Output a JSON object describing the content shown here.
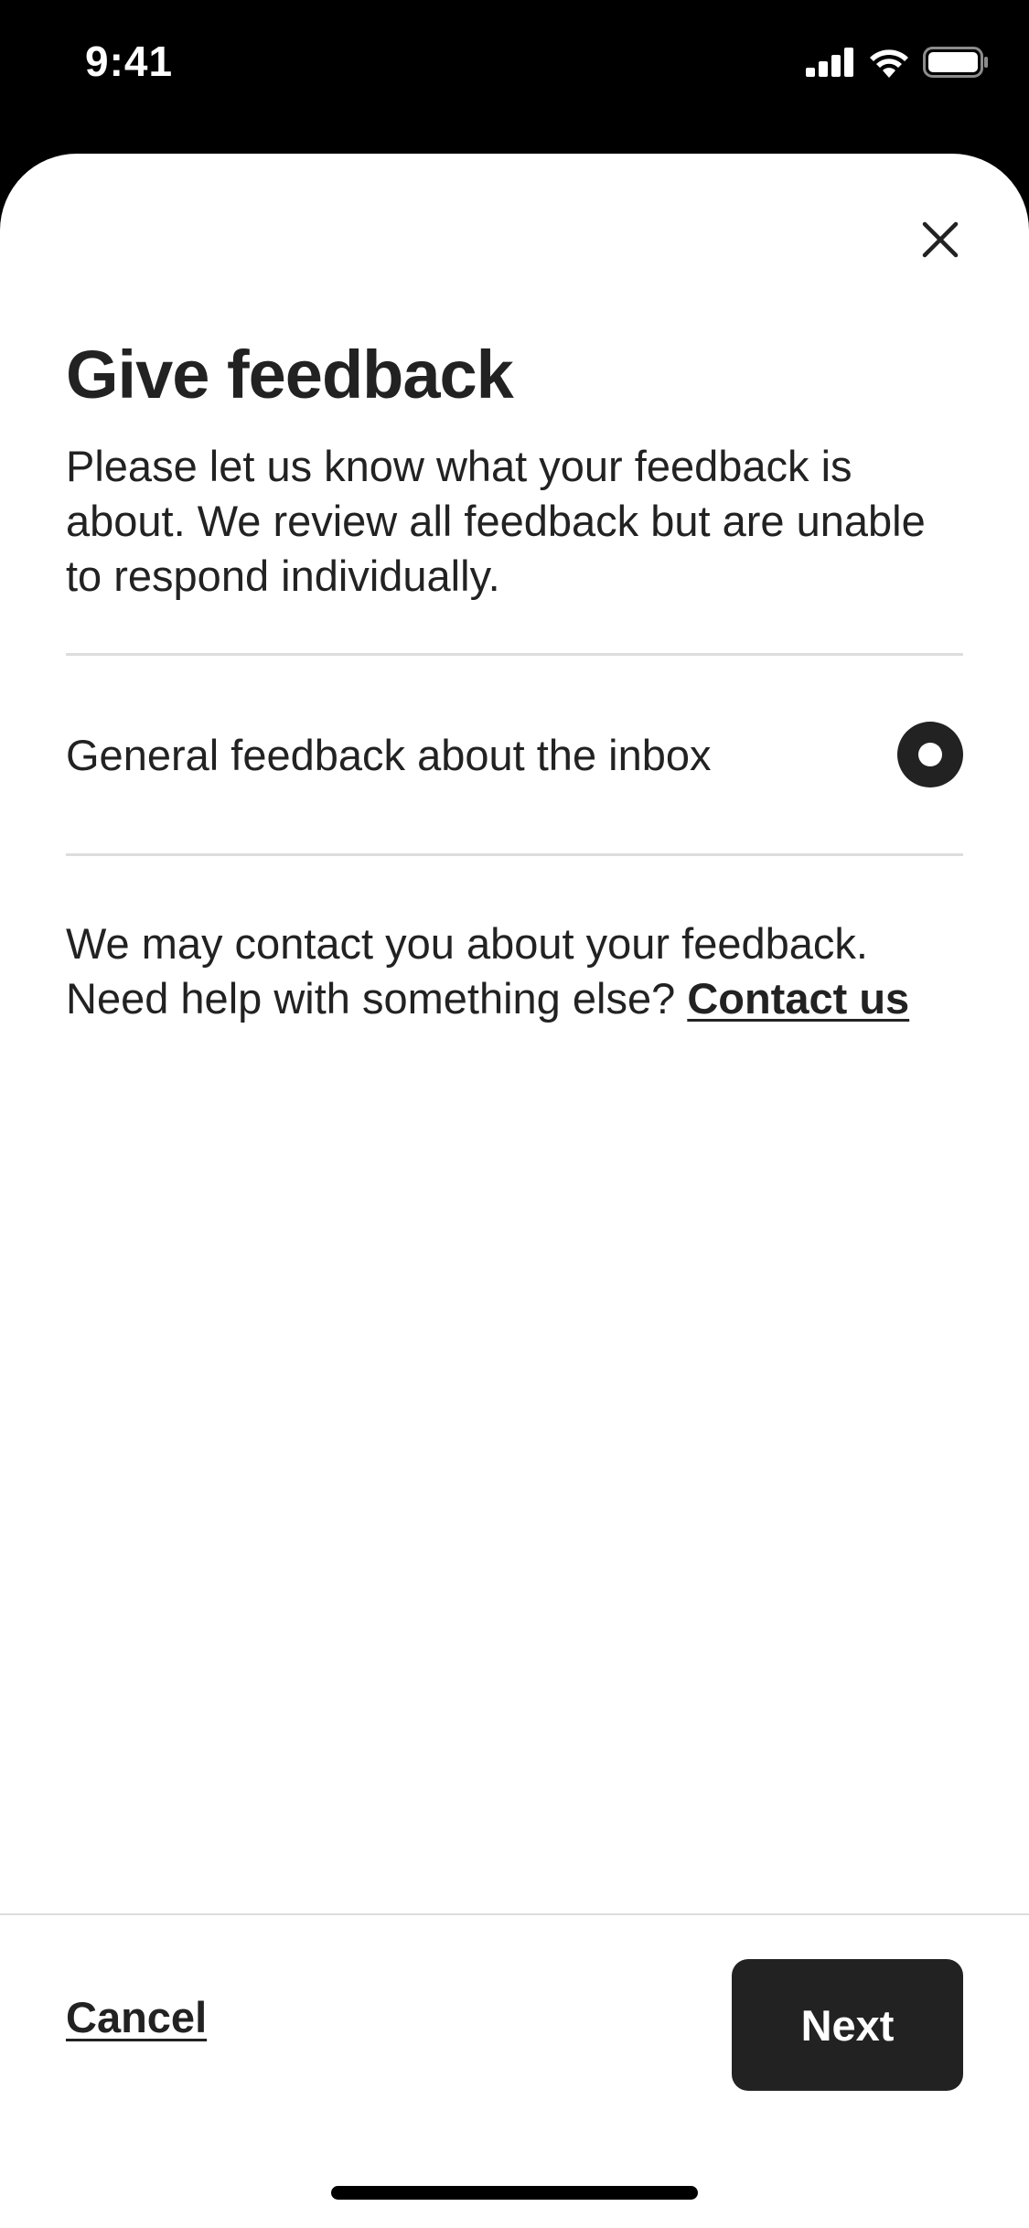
{
  "status_bar": {
    "time": "9:41",
    "icons": [
      "signal-icon",
      "wifi-icon",
      "battery-icon"
    ]
  },
  "sheet": {
    "close_icon": "close-icon",
    "title": "Give feedback",
    "description": "Please let us know what your feedback is about. We review all feedback but are unable to respond individually.",
    "options": [
      {
        "label": "General feedback about the inbox",
        "selected": true
      }
    ],
    "contact_text": "We may contact you about your feedback. Need help with something else?",
    "contact_link": "Contact us"
  },
  "footer": {
    "cancel_label": "Cancel",
    "next_label": "Next"
  },
  "colors": {
    "text": "#222222",
    "divider": "#dddddd",
    "background": "#ffffff",
    "primary_button": "#222222"
  }
}
